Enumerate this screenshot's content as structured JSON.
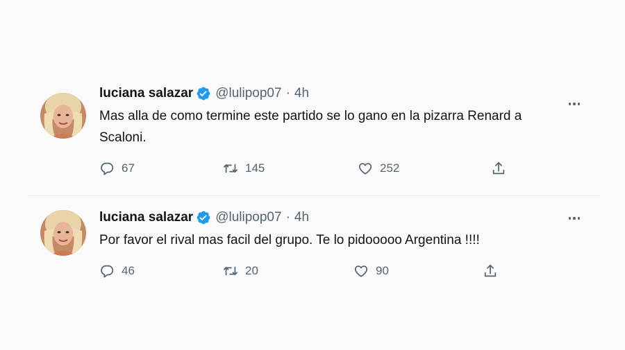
{
  "tweets": [
    {
      "display_name": "luciana salazar",
      "handle": "@lulipop07",
      "separator": "·",
      "time": "4h",
      "text": "Mas alla de como termine este partido se lo gano en la pizarra Renard a Scaloni.",
      "replies": "67",
      "retweets": "145",
      "likes": "252"
    },
    {
      "display_name": "luciana salazar",
      "handle": "@lulipop07",
      "separator": "·",
      "time": "4h",
      "text": "Por favor el rival mas facil del grupo. Te lo pidooooo Argentina !!!!",
      "replies": "46",
      "retweets": "20",
      "likes": "90"
    }
  ],
  "icons": {
    "verified": "verified-badge-icon",
    "more": "more-dots-icon",
    "reply": "reply-icon",
    "retweet": "retweet-icon",
    "like": "heart-icon",
    "share": "share-icon"
  },
  "colors": {
    "verified": "#1d9bf0",
    "secondary_text": "#536471",
    "primary_text": "#0f1419"
  }
}
